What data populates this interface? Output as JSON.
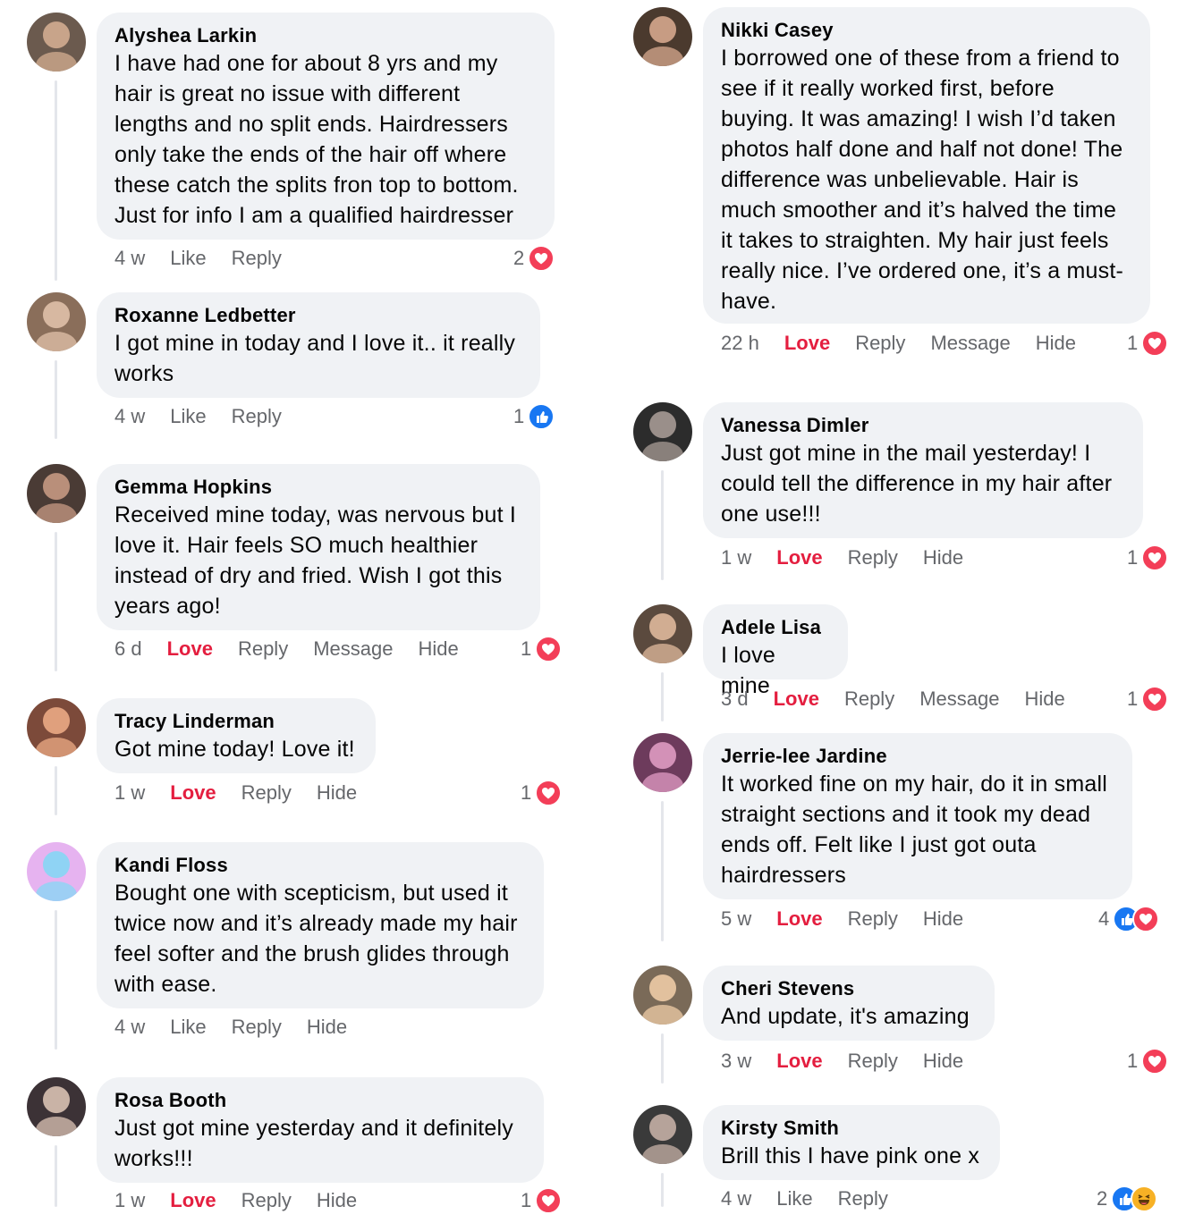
{
  "left_comments": [
    {
      "name": "Alyshea Larkin",
      "lines": [
        "I have had one for about 8 yrs and my",
        "hair is great no issue with different",
        "lengths and no split ends. Hairdressers",
        "only take the ends of the hair off where",
        "these catch the splits fron top to bottom.",
        "Just for info I am a qualified hairdresser"
      ],
      "time": "4 w",
      "actions": [
        "Like",
        "Reply"
      ],
      "count": "2",
      "reactions": [
        "love-icon"
      ]
    },
    {
      "name": "Roxanne Ledbetter",
      "lines": [
        "I got mine in today and I love it.. it really",
        "works"
      ],
      "time": "4 w",
      "actions": [
        "Like",
        "Reply"
      ],
      "count": "1",
      "reactions": [
        "like-icon"
      ]
    },
    {
      "name": "Gemma Hopkins",
      "lines": [
        "Received mine today, was nervous but I",
        "love it. Hair feels SO much healthier",
        "instead of dry and fried. Wish I got this",
        "years ago!"
      ],
      "time": "6 d",
      "actions": [
        "Love",
        "Reply",
        "Message",
        "Hide"
      ],
      "count": "1",
      "reactions": [
        "love-icon"
      ]
    },
    {
      "name": "Tracy Linderman",
      "lines": [
        "Got mine today! Love it!"
      ],
      "time": "1 w",
      "actions": [
        "Love",
        "Reply",
        "Hide"
      ],
      "count": "1",
      "reactions": [
        "love-icon"
      ]
    },
    {
      "name": "Kandi Floss",
      "lines": [
        "Bought one with scepticism, but used it",
        "twice now and it’s already made my hair",
        "feel softer and the brush glides through",
        "with ease."
      ],
      "time": "4 w",
      "actions": [
        "Like",
        "Reply",
        "Hide"
      ],
      "count": "",
      "reactions": []
    },
    {
      "name": "Rosa Booth",
      "lines": [
        "Just got mine yesterday and it definitely",
        "works!!!"
      ],
      "time": "1 w",
      "actions": [
        "Love",
        "Reply",
        "Hide"
      ],
      "count": "1",
      "reactions": [
        "love-icon"
      ]
    }
  ],
  "right_comments": [
    {
      "name": "Nikki Casey",
      "lines": [
        "I borrowed one of these from a friend to",
        "see if it really worked first, before",
        "buying. It was amazing! I wish I’d taken",
        "photos half done and half not done! The",
        "difference was unbelievable. Hair is",
        "much smoother and it’s halved the time",
        "it takes to straighten. My hair just feels",
        "really nice. I’ve ordered one, it’s a must-",
        "have."
      ],
      "time": "22 h",
      "actions": [
        "Love",
        "Reply",
        "Message",
        "Hide"
      ],
      "count": "1",
      "reactions": [
        "love-icon"
      ]
    },
    {
      "name": "Vanessa Dimler",
      "lines": [
        "Just got mine in the mail yesterday! I",
        "could tell the difference in my hair after",
        "one use!!!"
      ],
      "time": "1 w",
      "actions": [
        "Love",
        "Reply",
        "Hide"
      ],
      "count": "1",
      "reactions": [
        "love-icon"
      ]
    },
    {
      "name": "Adele Lisa",
      "lines": [
        "I love mine"
      ],
      "time": "3 d",
      "actions": [
        "Love",
        "Reply",
        "Message",
        "Hide"
      ],
      "count": "1",
      "reactions": [
        "love-icon"
      ]
    },
    {
      "name": "Jerrie-lee Jardine",
      "lines": [
        "It worked fine on my hair, do it in small",
        "straight sections and it took my dead",
        "ends off. Felt like I just got outa",
        "hairdressers"
      ],
      "time": "5 w",
      "actions": [
        "Love",
        "Reply",
        "Hide"
      ],
      "count": "4",
      "reactions": [
        "like-icon",
        "love-icon"
      ]
    },
    {
      "name": "Cheri Stevens",
      "lines": [
        "And update, it's amazing"
      ],
      "time": "3 w",
      "actions": [
        "Love",
        "Reply",
        "Hide"
      ],
      "count": "1",
      "reactions": [
        "love-icon"
      ]
    },
    {
      "name": "Kirsty Smith",
      "lines": [
        "Brill this I have pink one x"
      ],
      "time": "4 w",
      "actions": [
        "Like",
        "Reply"
      ],
      "count": "2",
      "reactions": [
        "like-icon",
        "haha-icon"
      ]
    }
  ],
  "colors": {
    "accent_love": "#e41e3f",
    "like_blue": "#1877f2",
    "bubble": "#f0f2f5",
    "meta_text": "#65676b"
  }
}
